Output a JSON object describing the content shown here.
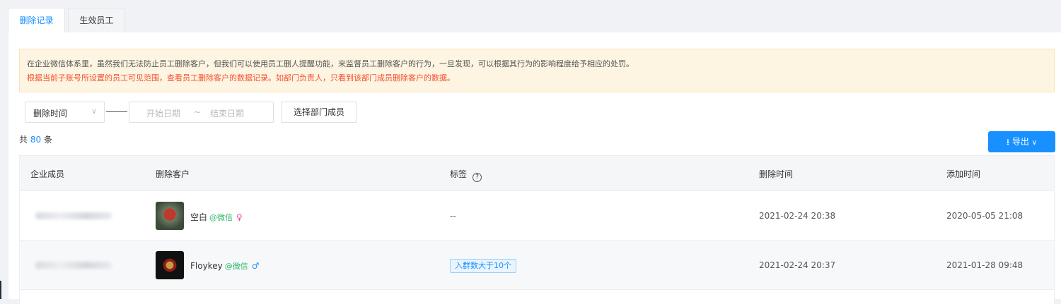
{
  "tabs": [
    {
      "label": "删除记录",
      "active": true
    },
    {
      "label": "生效员工",
      "active": false
    }
  ],
  "notice": {
    "line1": "在企业微信体系里，虽然我们无法防止员工删除客户，但我们可以使用员工删人提醒功能，来监督员工删除客户的行为，一旦发现，可以根据其行为的影响程度给予相应的处罚。",
    "line2": "根据当前子账号所设置的员工可见范围，查看员工删除客户的数据记录。如部门负责人，只看到该部门成员删除客户的数据。"
  },
  "filters": {
    "time_select": "删除时间",
    "start_placeholder": "开始日期",
    "range_sep": "~",
    "end_placeholder": "结束日期",
    "member_button": "选择部门成员"
  },
  "count": {
    "prefix": "共",
    "value": "80",
    "suffix": "条"
  },
  "export_button": "导出",
  "table": {
    "headers": [
      "企业成员",
      "删除客户",
      "标签",
      "删除时间",
      "添加时间"
    ],
    "rows": [
      {
        "customer": "空白",
        "source": "@微信",
        "gender": "♀",
        "tag": "--",
        "deleted_at": "2021-02-24 20:38",
        "added_at": "2020-05-05 21:08"
      },
      {
        "customer": "Floykey",
        "source": "@微信",
        "gender": "♂",
        "tag": "入群数大于10个",
        "deleted_at": "2021-02-24 20:37",
        "added_at": "2021-01-28 09:48"
      }
    ]
  },
  "colors": {
    "accent": "#1890ff",
    "warning_text": "#f5502c",
    "notice_bg": "#fef4e2",
    "wechat_green": "#2db766"
  },
  "icons": [
    "chevron-down-icon",
    "download-icon",
    "help-circle-icon",
    "female-icon",
    "male-icon"
  ]
}
